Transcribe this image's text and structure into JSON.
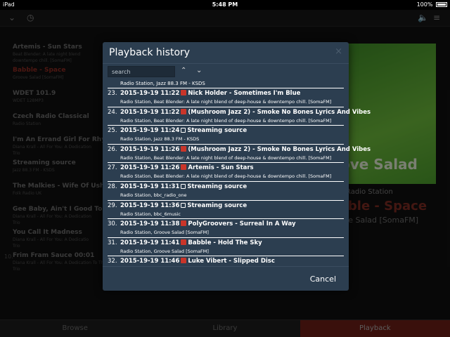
{
  "status": {
    "device": "iPad",
    "time": "5:48 PM",
    "battery": "100%"
  },
  "playlist": [
    {
      "title": "Artemis - Sun Stars",
      "sub": "Beat Blender: A late night blend",
      "sub2": "downtempo chill. [SomaFM]"
    },
    {
      "title": "Babble - Space",
      "sub": "Groove Salad [SomaFM]",
      "active": true
    },
    {
      "title": "WDET 101.9",
      "sub": "WDET 128MP3"
    },
    {
      "title": "Czech Radio Classical",
      "sub": "Radio Station"
    },
    {
      "title": "I'm An Errand Girl For Rhyt",
      "sub": "Diana Krall - All For You: A Dedication",
      "sub2": "Trio"
    },
    {
      "title": "Streaming source",
      "sub": "Jazz 88.3 FM - KSDS"
    },
    {
      "title": "The Malkies - Wife Of Ushe",
      "sub": "Folk Radio UK"
    },
    {
      "title": "Gee Baby, Ain't I Good To Y",
      "sub": "Diana Krall - All For You: A Dedication",
      "sub2": "Trio"
    },
    {
      "title": "You Call It Madness",
      "sub": "Diana Krall - All For You: A Dedicatio",
      "sub2": "Trio"
    },
    {
      "title": "Frim Fram Sauce",
      "time": "00:01",
      "sub": "Diana Krall - All For You: A Dedication To The Nat King Cole",
      "sub2": "Trio",
      "num": "10."
    }
  ],
  "now_playing": {
    "art_text": "ove Salad",
    "station": "Radio Station",
    "track": "bble - Space",
    "sub": "ove Salad [SomaFM]"
  },
  "tabs": [
    "Browse",
    "Library",
    "Playback"
  ],
  "modal": {
    "title": "Playback history",
    "close": "×",
    "search_placeholder": "search",
    "cancel": "Cancel",
    "first_sub": "Radio Station, Jazz 88.3 FM - KSDS",
    "entries": [
      {
        "num": "23.",
        "date": "2015-19-19 11:22",
        "icon": "red",
        "title": "Nick Holder - Sometimes I'm Blue",
        "sub": "Radio Station, Beat Blender: A late night blend of deep-house & downtempo chill. [SomaFM]"
      },
      {
        "num": "24.",
        "date": "2015-19-19 11:22",
        "icon": "red",
        "title": "(Mushroom Jazz 2) - Smoke No Bones Lyrics And Vibes",
        "sub": "Radio Station, Beat Blender: A late night blend of deep-house & downtempo chill. [SomaFM]"
      },
      {
        "num": "25.",
        "date": "2015-19-19 11:24",
        "icon": "link",
        "title": "Streaming source",
        "sub": "Radio Station, Jazz 88.3 FM - KSDS"
      },
      {
        "num": "26.",
        "date": "2015-19-19 11:26",
        "icon": "red",
        "title": "(Mushroom Jazz 2) - Smoke No Bones Lyrics And Vibes",
        "sub": "Radio Station, Beat Blender: A late night blend of deep-house & downtempo chill. [SomaFM]"
      },
      {
        "num": "27.",
        "date": "2015-19-19 11:26",
        "icon": "red",
        "title": "Artemis - Sun Stars",
        "sub": "Radio Station, Beat Blender: A late night blend of deep-house & downtempo chill. [SomaFM]"
      },
      {
        "num": "28.",
        "date": "2015-19-19 11:31",
        "icon": "link",
        "title": "Streaming source",
        "sub": "Radio Station, bbc_radio_one"
      },
      {
        "num": "29.",
        "date": "2015-19-19 11:36",
        "icon": "link",
        "title": "Streaming source",
        "sub": "Radio Station, bbc_6music"
      },
      {
        "num": "30.",
        "date": "2015-19-19 11:38",
        "icon": "red",
        "title": "PolyGroovers - Surreal In A Way",
        "sub": "Radio Station, Groove Salad [SomaFM]"
      },
      {
        "num": "31.",
        "date": "2015-19-19 11:41",
        "icon": "red",
        "title": "Babble - Hold The Sky",
        "sub": "Radio Station, Groove Salad [SomaFM]"
      },
      {
        "num": "32.",
        "date": "2015-19-19 11:46",
        "icon": "red",
        "title": "Luke Vibert - Slipped Disc",
        "sub": ""
      }
    ]
  },
  "colors": {
    "modal_bg": "#2c3e50",
    "accent_red": "#c9352a",
    "playback_tab": "#6b1e16"
  }
}
